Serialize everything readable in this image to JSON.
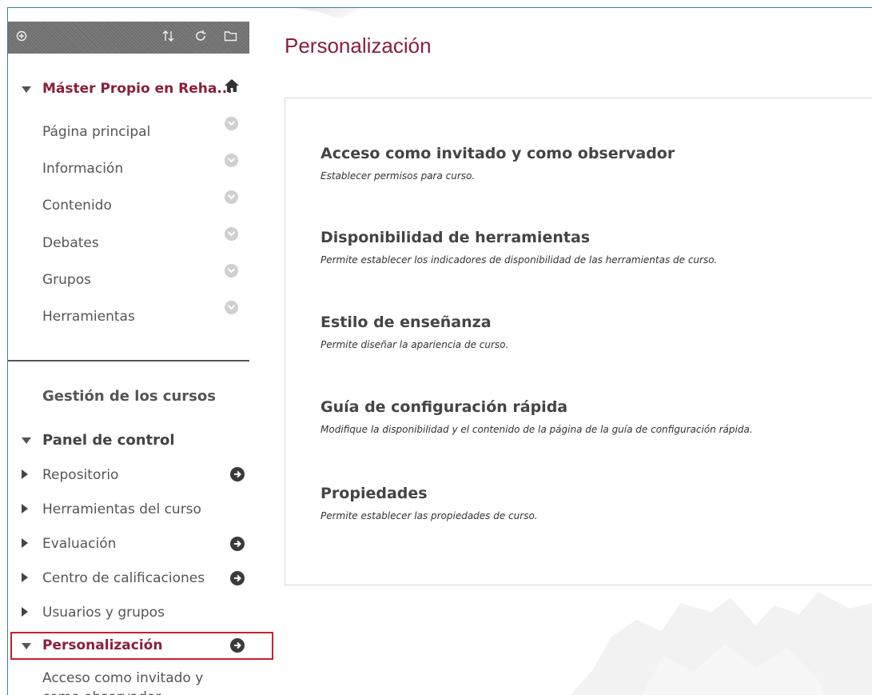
{
  "toolbar": {
    "icons": [
      "add-circle-icon",
      "sort-icon",
      "refresh-icon",
      "folder-icon"
    ]
  },
  "sidebar": {
    "course_title": "Máster Propio en Reha...",
    "items": [
      {
        "label": "Página principal"
      },
      {
        "label": "Información"
      },
      {
        "label": "Contenido"
      },
      {
        "label": "Debates"
      },
      {
        "label": "Grupos"
      },
      {
        "label": "Herramientas"
      }
    ],
    "management_title": "Gestión de los cursos",
    "control_panel_title": "Panel de control",
    "control_items": [
      {
        "label": "Repositorio",
        "has_arrow": true
      },
      {
        "label": "Herramientas del curso",
        "has_arrow": false
      },
      {
        "label": "Evaluación",
        "has_arrow": true
      },
      {
        "label": "Centro de calificaciones",
        "has_arrow": true
      },
      {
        "label": "Usuarios y grupos",
        "has_arrow": false
      }
    ],
    "selected_item": "Personalización",
    "selected_sub_item": "Acceso como invitado y como observador"
  },
  "main": {
    "title": "Personalización",
    "entries": [
      {
        "title": "Acceso como invitado y como observador",
        "desc": "Establecer permisos para curso."
      },
      {
        "title": "Disponibilidad de herramientas",
        "desc": "Permite establecer los indicadores de disponibilidad de las herramientas de curso."
      },
      {
        "title": "Estilo de enseñanza",
        "desc": "Permite diseñar la apariencia de curso."
      },
      {
        "title": "Guía de configuración rápida",
        "desc": "Modifique la disponibilidad y el contenido de la página de la guía de configuración rápida."
      },
      {
        "title": "Propiedades",
        "desc": "Permite establecer las propiedades de curso."
      }
    ]
  },
  "colors": {
    "accent": "#8a1f3b",
    "frame": "#2e8b87",
    "highlight": "#c8202a"
  }
}
